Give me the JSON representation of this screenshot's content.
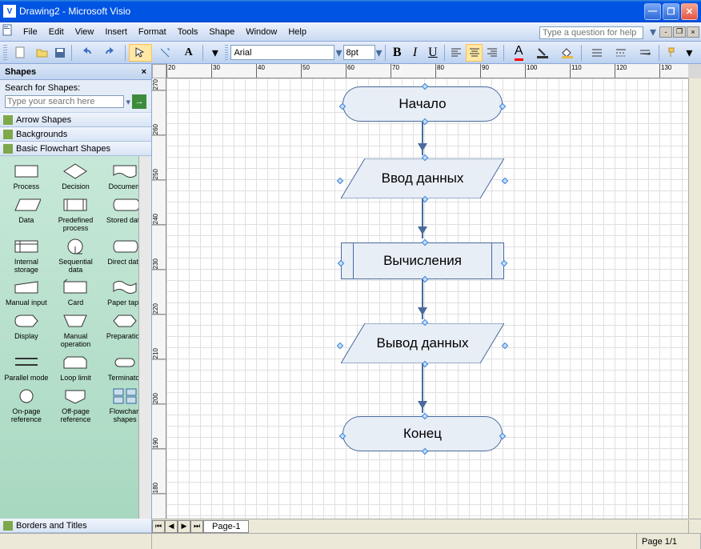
{
  "titlebar": {
    "title": "Drawing2 - Microsoft Visio"
  },
  "menu": {
    "items": [
      "File",
      "Edit",
      "View",
      "Insert",
      "Format",
      "Tools",
      "Shape",
      "Window",
      "Help"
    ],
    "help_placeholder": "Type a question for help"
  },
  "toolbar": {
    "font_name": "Arial",
    "font_size": "8pt"
  },
  "shapes_panel": {
    "title": "Shapes",
    "search_label": "Search for Shapes:",
    "search_placeholder": "Type your search here",
    "stencils": [
      "Arrow Shapes",
      "Backgrounds",
      "Basic Flowchart Shapes",
      "Borders and Titles"
    ],
    "shapes": [
      {
        "label": "Process"
      },
      {
        "label": "Decision"
      },
      {
        "label": "Document"
      },
      {
        "label": "Data"
      },
      {
        "label": "Predefined process"
      },
      {
        "label": "Stored data"
      },
      {
        "label": "Internal storage"
      },
      {
        "label": "Sequential data"
      },
      {
        "label": "Direct data"
      },
      {
        "label": "Manual input"
      },
      {
        "label": "Card"
      },
      {
        "label": "Paper tape"
      },
      {
        "label": "Display"
      },
      {
        "label": "Manual operation"
      },
      {
        "label": "Preparation"
      },
      {
        "label": "Parallel mode"
      },
      {
        "label": "Loop limit"
      },
      {
        "label": "Terminator"
      },
      {
        "label": "On-page reference"
      },
      {
        "label": "Off-page reference"
      },
      {
        "label": "Flowchart shapes"
      }
    ]
  },
  "canvas": {
    "page_tab": "Page-1",
    "ruler_h": [
      "20",
      "30",
      "40",
      "50",
      "60",
      "70",
      "80",
      "90",
      "100",
      "110",
      "120",
      "130"
    ],
    "ruler_v": [
      "270",
      "260",
      "250",
      "240",
      "230",
      "220",
      "210",
      "200",
      "190",
      "180"
    ],
    "flowchart": {
      "start": "Начало",
      "input": "Ввод данных",
      "process": "Вычисления",
      "output": "Вывод данных",
      "end": "Конец"
    }
  },
  "statusbar": {
    "page": "Page 1/1"
  }
}
